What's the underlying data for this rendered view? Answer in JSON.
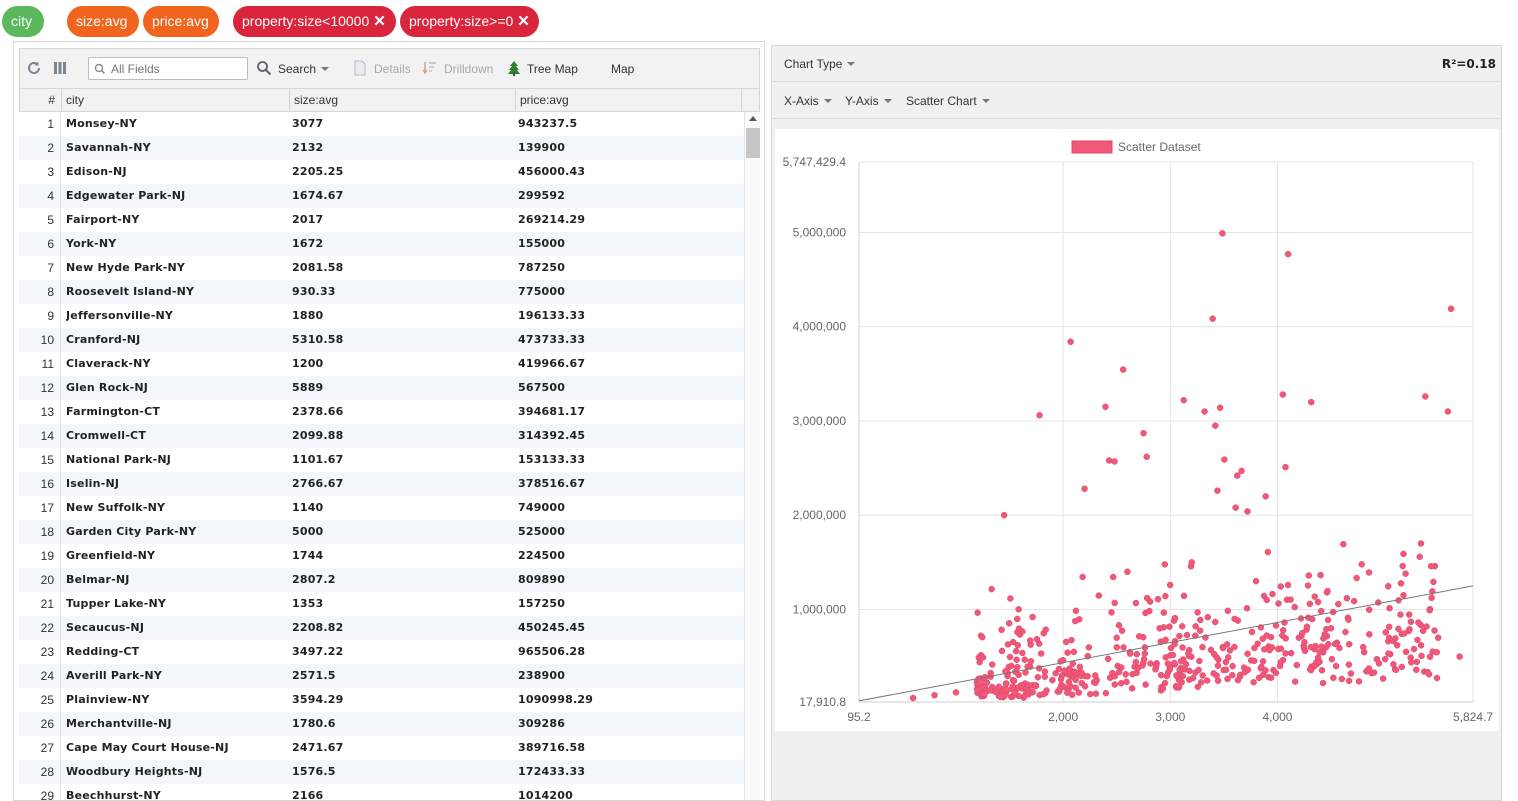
{
  "filters": [
    {
      "label": "city",
      "removable": false,
      "color": "#5cb85c"
    },
    {
      "label": "size:avg",
      "removable": false,
      "color": "#f0641e"
    },
    {
      "label": "price:avg",
      "removable": false,
      "color": "#f0641e"
    },
    {
      "label": "property:size<10000",
      "removable": true,
      "color": "#d9263d"
    },
    {
      "label": "property:size>=0",
      "removable": true,
      "color": "#d9263d"
    }
  ],
  "toolbar": {
    "search_placeholder": "All Fields",
    "search_label": "Search",
    "details_label": "Details",
    "drilldown_label": "Drilldown",
    "treemap_label": "Tree Map",
    "map_label": "Map"
  },
  "grid": {
    "columns": [
      "#",
      "city",
      "size:avg",
      "price:avg"
    ],
    "rows": [
      [
        "1",
        "Monsey-NY",
        "3077",
        "943237.5"
      ],
      [
        "2",
        "Savannah-NY",
        "2132",
        "139900"
      ],
      [
        "3",
        "Edison-NJ",
        "2205.25",
        "456000.43"
      ],
      [
        "4",
        "Edgewater Park-NJ",
        "1674.67",
        "299592"
      ],
      [
        "5",
        "Fairport-NY",
        "2017",
        "269214.29"
      ],
      [
        "6",
        "York-NY",
        "1672",
        "155000"
      ],
      [
        "7",
        "New Hyde Park-NY",
        "2081.58",
        "787250"
      ],
      [
        "8",
        "Roosevelt Island-NY",
        "930.33",
        "775000"
      ],
      [
        "9",
        "Jeffersonville-NY",
        "1880",
        "196133.33"
      ],
      [
        "10",
        "Cranford-NJ",
        "5310.58",
        "473733.33"
      ],
      [
        "11",
        "Claverack-NY",
        "1200",
        "419966.67"
      ],
      [
        "12",
        "Glen Rock-NJ",
        "5889",
        "567500"
      ],
      [
        "13",
        "Farmington-CT",
        "2378.66",
        "394681.17"
      ],
      [
        "14",
        "Cromwell-CT",
        "2099.88",
        "314392.45"
      ],
      [
        "15",
        "National Park-NJ",
        "1101.67",
        "153133.33"
      ],
      [
        "16",
        "Iselin-NJ",
        "2766.67",
        "378516.67"
      ],
      [
        "17",
        "New Suffolk-NY",
        "1140",
        "749000"
      ],
      [
        "18",
        "Garden City Park-NY",
        "5000",
        "525000"
      ],
      [
        "19",
        "Greenfield-NY",
        "1744",
        "224500"
      ],
      [
        "20",
        "Belmar-NJ",
        "2807.2",
        "809890"
      ],
      [
        "21",
        "Tupper Lake-NY",
        "1353",
        "157250"
      ],
      [
        "22",
        "Secaucus-NJ",
        "2208.82",
        "450245.45"
      ],
      [
        "23",
        "Redding-CT",
        "3497.22",
        "965506.28"
      ],
      [
        "24",
        "Averill Park-NY",
        "2571.5",
        "238900"
      ],
      [
        "25",
        "Plainview-NY",
        "3594.29",
        "1090998.29"
      ],
      [
        "26",
        "Merchantville-NJ",
        "1780.6",
        "309286"
      ],
      [
        "27",
        "Cape May Court House-NJ",
        "2471.67",
        "389716.58"
      ],
      [
        "28",
        "Woodbury Heights-NJ",
        "1576.5",
        "172433.33"
      ],
      [
        "29",
        "Beechhurst-NY",
        "2166",
        "1014200"
      ]
    ]
  },
  "chart_panel": {
    "chart_type_label": "Chart Type",
    "r2_label": "R²=0.18",
    "x_axis_label": "X-Axis",
    "y_axis_label": "Y-Axis",
    "chart_style_label": "Scatter Chart"
  },
  "chart_data": {
    "type": "scatter",
    "legend": "Scatter Dataset",
    "legend_position": "top",
    "color": "#f0587a",
    "xlim": [
      95.2,
      5824.7
    ],
    "ylim": [
      17910.8,
      5747429.4
    ],
    "x_tick_labels": [
      "95.2",
      "2,000",
      "3,000",
      "4,000",
      "5,824.7"
    ],
    "y_tick_labels": [
      "17,910.8",
      "1,000,000",
      "2,000,000",
      "3,000,000",
      "4,000,000",
      "5,000,000",
      "5,747,429.4"
    ],
    "x_ticks": [
      95.2,
      2000,
      3000,
      4000,
      5824.7
    ],
    "y_ticks": [
      17910.8,
      1000000,
      2000000,
      3000000,
      4000000,
      5000000,
      5747429.4
    ],
    "grid": true,
    "trendline": {
      "from": [
        95.2,
        30000
      ],
      "to": [
        5824.7,
        1250000
      ]
    },
    "outliers": [
      [
        3486,
        4990000
      ],
      [
        4100,
        4770000
      ],
      [
        3395,
        4085000
      ],
      [
        5620,
        4190000
      ],
      [
        2070,
        3840000
      ],
      [
        2560,
        3545000
      ],
      [
        1780,
        3060000
      ],
      [
        2395,
        3150000
      ],
      [
        3125,
        3220000
      ],
      [
        3320,
        3100000
      ],
      [
        3465,
        3140000
      ],
      [
        3420,
        2950000
      ],
      [
        4050,
        3280000
      ],
      [
        4315,
        3200000
      ],
      [
        5590,
        3100000
      ],
      [
        5380,
        3260000
      ],
      [
        2750,
        2870000
      ],
      [
        2780,
        2620000
      ],
      [
        2430,
        2580000
      ],
      [
        2480,
        2570000
      ],
      [
        3505,
        2590000
      ],
      [
        3665,
        2470000
      ],
      [
        3625,
        2420000
      ],
      [
        3610,
        2080000
      ],
      [
        3440,
        2260000
      ],
      [
        3720,
        2040000
      ],
      [
        3890,
        2200000
      ],
      [
        4075,
        2510000
      ],
      [
        2200,
        2280000
      ],
      [
        1450,
        2000000
      ]
    ],
    "cloud": [
      [
        2500,
        700000
      ],
      [
        2900,
        800000
      ],
      [
        3300,
        600000
      ],
      [
        1700,
        450000
      ],
      [
        2100,
        550000
      ],
      [
        3600,
        900000
      ],
      [
        4200,
        700000
      ],
      [
        4800,
        600000
      ],
      [
        5200,
        550000
      ],
      [
        2300,
        300000
      ],
      [
        1900,
        250000
      ],
      [
        3100,
        450000
      ],
      [
        2700,
        380000
      ],
      [
        4500,
        800000
      ],
      [
        3900,
        1100000
      ],
      [
        1400,
        180000
      ],
      [
        1200,
        150000
      ],
      [
        1000,
        120000
      ],
      [
        800,
        90000
      ],
      [
        600,
        60000
      ],
      [
        5500,
        700000
      ],
      [
        5700,
        500000
      ],
      [
        3800,
        1300000
      ],
      [
        3200,
        1500000
      ],
      [
        2600,
        1400000
      ]
    ]
  }
}
